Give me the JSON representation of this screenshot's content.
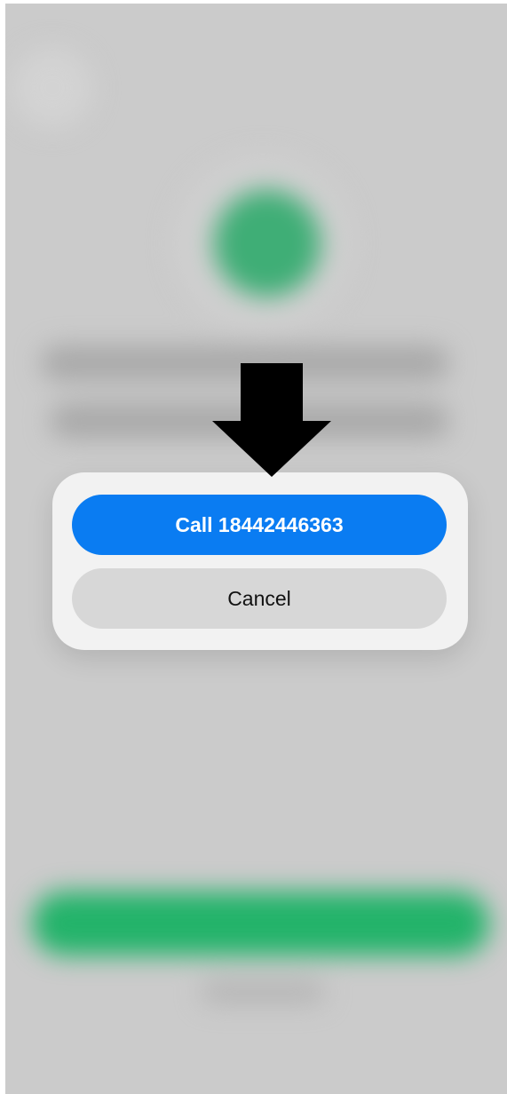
{
  "dialog": {
    "call_label": "Call 18442446363",
    "cancel_label": "Cancel"
  },
  "colors": {
    "call_button": "#0a7cf2",
    "cancel_button": "#d7d7d7",
    "sheet_background": "#f2f2f2",
    "dimmed_background": "#cbcbcb",
    "blurred_primary_button": "#23b36a",
    "blurred_avatar": "#3fae76",
    "annotation_arrow": "#000000"
  },
  "icons": {
    "annotation": "down-arrow-icon"
  }
}
